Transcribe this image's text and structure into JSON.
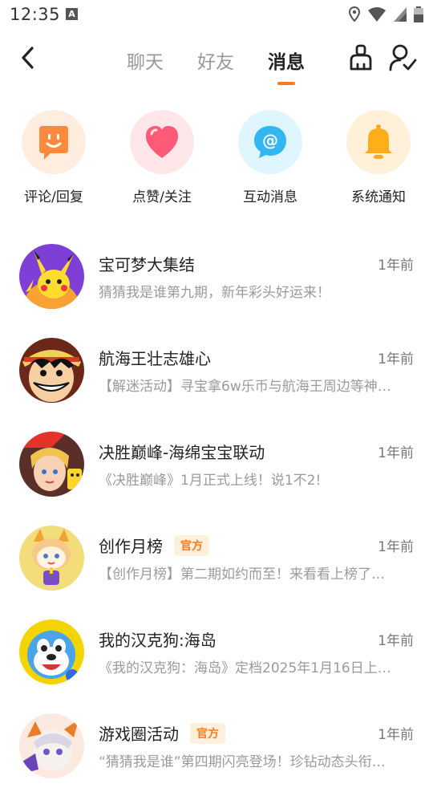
{
  "status_bar": {
    "time": "12:35",
    "badge": "A"
  },
  "header": {
    "tabs": [
      {
        "label": "聊天",
        "active": false
      },
      {
        "label": "好友",
        "active": false
      },
      {
        "label": "消息",
        "active": true
      }
    ],
    "accent": "#ff7a1a"
  },
  "quick_actions": [
    {
      "label": "评论/回复",
      "icon": "comment-smile-icon",
      "bg": "#ffede0",
      "color": "#ff8a3d"
    },
    {
      "label": "点赞/关注",
      "icon": "heart-icon",
      "bg": "#ffe7e9",
      "color": "#ff5a78"
    },
    {
      "label": "互动消息",
      "icon": "at-chat-icon",
      "bg": "#dff6ff",
      "color": "#33b7f0"
    },
    {
      "label": "系统通知",
      "icon": "bell-icon",
      "bg": "#fff1d9",
      "color": "#ffae1a"
    }
  ],
  "messages": [
    {
      "title": "宝可梦大集结",
      "official": false,
      "time": "1年前",
      "preview": "猜猜我是谁第九期，新年彩头好运来！"
    },
    {
      "title": "航海王壮志雄心",
      "official": false,
      "time": "1年前",
      "preview": "【解迷活动】寻宝拿6w乐币与航海王周边等神…"
    },
    {
      "title": "决胜巅峰-海绵宝宝联动",
      "official": false,
      "time": "1年前",
      "preview": "《决胜巅峰》1月正式上线！说1不2!"
    },
    {
      "title": "创作月榜",
      "official": true,
      "badge": "官方",
      "time": "1年前",
      "preview": "【创作月榜】第二期如约而至！来看看上榜了…"
    },
    {
      "title": "我的汉克狗:海岛",
      "official": false,
      "time": "1年前",
      "preview": "《我的汉克狗：海岛》定档2025年1月16日上…"
    },
    {
      "title": "游戏圈活动",
      "official": true,
      "badge": "官方",
      "time": "1年前",
      "preview": "“猜猜我是谁”第四期闪亮登场！珍钻动态头衔…"
    }
  ],
  "avatar_art": [
    "pikachu-avatar",
    "luffy-avatar",
    "game-hero-avatar",
    "cartoon-fox-avatar",
    "talking-dog-avatar",
    "anime-girl-avatar"
  ]
}
